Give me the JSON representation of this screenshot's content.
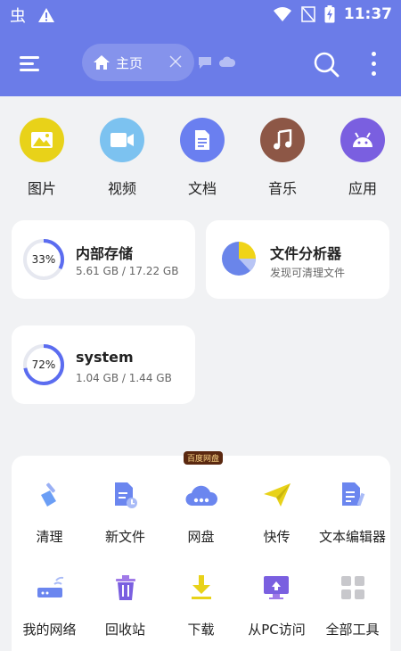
{
  "status_bar": {
    "time": "11:37"
  },
  "header": {
    "current_tab": "主页"
  },
  "categories": [
    {
      "label": "图片",
      "icon": "image-icon",
      "color": "#e8d219"
    },
    {
      "label": "视频",
      "icon": "video-icon",
      "color": "#7cc2f0"
    },
    {
      "label": "文档",
      "icon": "document-icon",
      "color": "#6a7ff0"
    },
    {
      "label": "音乐",
      "icon": "music-icon",
      "color": "#8d5746"
    },
    {
      "label": "应用",
      "icon": "android-icon",
      "color": "#7a5fe0"
    }
  ],
  "storage": {
    "internal": {
      "title": "内部存储",
      "percent_label": "33%",
      "percent": 33,
      "usage": "5.61 GB / 17.22 GB"
    },
    "analyzer": {
      "title": "文件分析器",
      "subtitle": "发现可清理文件"
    },
    "system": {
      "title": "system",
      "percent_label": "72%",
      "percent": 72,
      "usage": "1.04 GB / 1.44 GB"
    }
  },
  "tools": {
    "badge": "百度网盘",
    "items": [
      {
        "label": "清理",
        "icon": "broom-icon"
      },
      {
        "label": "新文件",
        "icon": "new-file-icon"
      },
      {
        "label": "网盘",
        "icon": "cloud-drive-icon"
      },
      {
        "label": "快传",
        "icon": "paper-plane-icon"
      },
      {
        "label": "文本编辑器",
        "icon": "text-editor-icon"
      },
      {
        "label": "我的网络",
        "icon": "router-icon"
      },
      {
        "label": "回收站",
        "icon": "trash-icon"
      },
      {
        "label": "下载",
        "icon": "download-icon"
      },
      {
        "label": "从PC访问",
        "icon": "pc-access-icon"
      },
      {
        "label": "全部工具",
        "icon": "grid-icon"
      }
    ]
  },
  "colors": {
    "accent": "#6b7ce8",
    "ring": "#5b6cf0"
  }
}
